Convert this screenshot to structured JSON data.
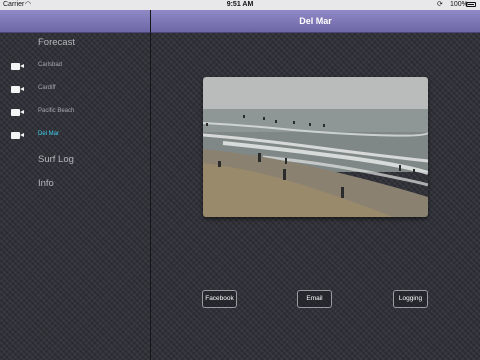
{
  "status_bar": {
    "carrier": "Carrier",
    "time": "9:51 AM",
    "battery": "100%"
  },
  "sidebar": {
    "sections": {
      "forecast": "Forecast",
      "surf_log": "Surf Log",
      "info": "Info"
    },
    "cameras": [
      {
        "label": "Carlsbad",
        "icon": "video-camera-icon"
      },
      {
        "label": "Cardiff",
        "icon": "video-camera-icon"
      },
      {
        "label": "Pacific Beach",
        "icon": "video-camera-icon"
      },
      {
        "label": "Del Mar",
        "icon": "video-camera-icon",
        "selected": true
      }
    ]
  },
  "main": {
    "title": "Del Mar",
    "buttons": {
      "facebook": "Facebook",
      "email": "Email",
      "logging": "Logging"
    }
  },
  "colors": {
    "nav_bar": "#7d78b8",
    "selected_item": "#3ed0f2",
    "background": "#2e2f36"
  }
}
